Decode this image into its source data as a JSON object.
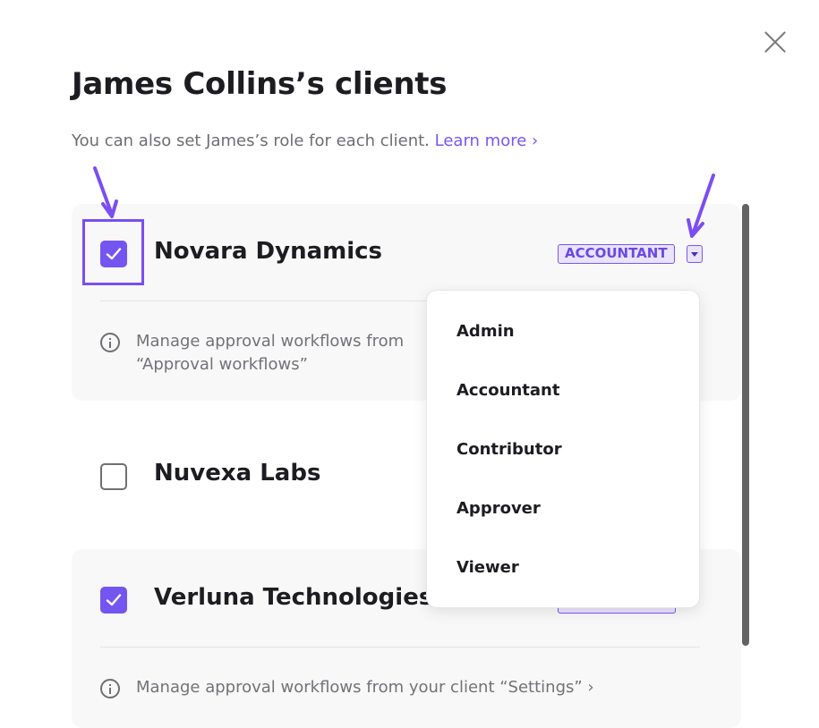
{
  "dialog": {
    "title": "James Collins’s clients",
    "subtitle": "You can also set James’s role for each client.",
    "learn_more": "Learn more ›",
    "close_icon": "close-icon"
  },
  "clients": [
    {
      "name": "Novara Dynamics",
      "checked": true,
      "role": "ACCOUNTANT",
      "info_line1": "Manage approval workflows from",
      "info_line2": "“Approval workflows”"
    },
    {
      "name": "Nuvexa Labs",
      "checked": false
    },
    {
      "name": "Verluna Technologies",
      "checked": true,
      "info": "Manage approval workflows from your client “Settings” ›"
    }
  ],
  "role_menu": {
    "items": [
      "Admin",
      "Accountant",
      "Contributor",
      "Approver",
      "Viewer"
    ]
  },
  "colors": {
    "accent": "#7455f0",
    "annotation": "#7a4ef2",
    "badge_bg": "#e9e3fd",
    "card_bg": "#f8f8f8"
  }
}
